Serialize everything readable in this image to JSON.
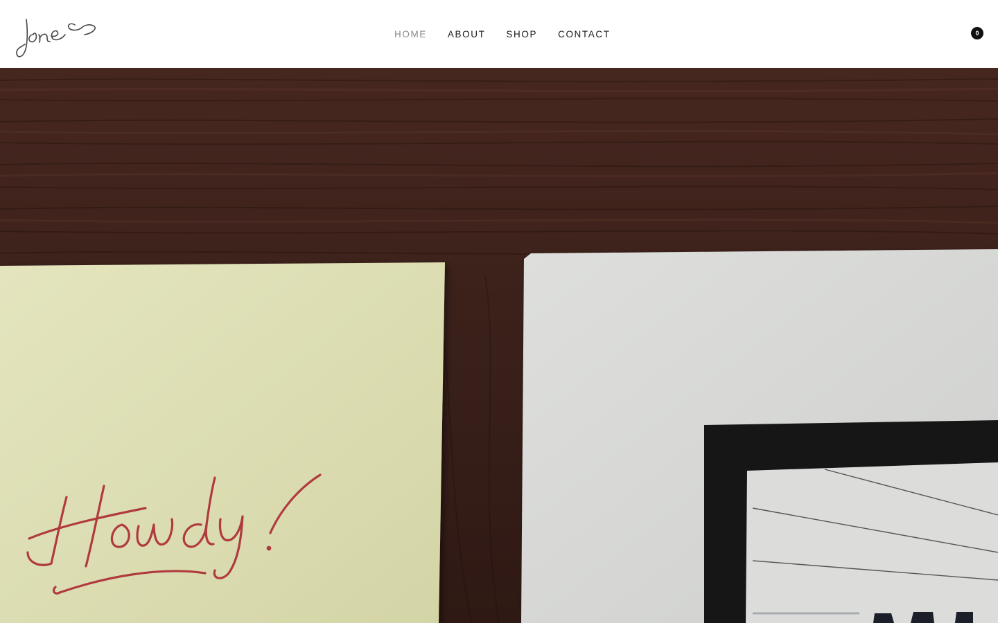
{
  "brand": {
    "logo_text": "Jones"
  },
  "nav": {
    "items": [
      {
        "label": "HOME",
        "active": true
      },
      {
        "label": "ABOUT",
        "active": false
      },
      {
        "label": "SHOP",
        "active": false
      },
      {
        "label": "CONTACT",
        "active": false
      }
    ]
  },
  "cart": {
    "count": "0",
    "icon": "cart-count-badge"
  },
  "hero": {
    "note_text": "Howdy!",
    "colors": {
      "wood": "#3e221c",
      "sticky_note": "#dfe0b2",
      "card": "#d9dad8",
      "ink_red": "#b03a3e",
      "frame": "#161616"
    }
  },
  "theme": {
    "nav_text": "#1a1a1a",
    "nav_active": "#8a8a8a",
    "header_bg": "#ffffff"
  }
}
